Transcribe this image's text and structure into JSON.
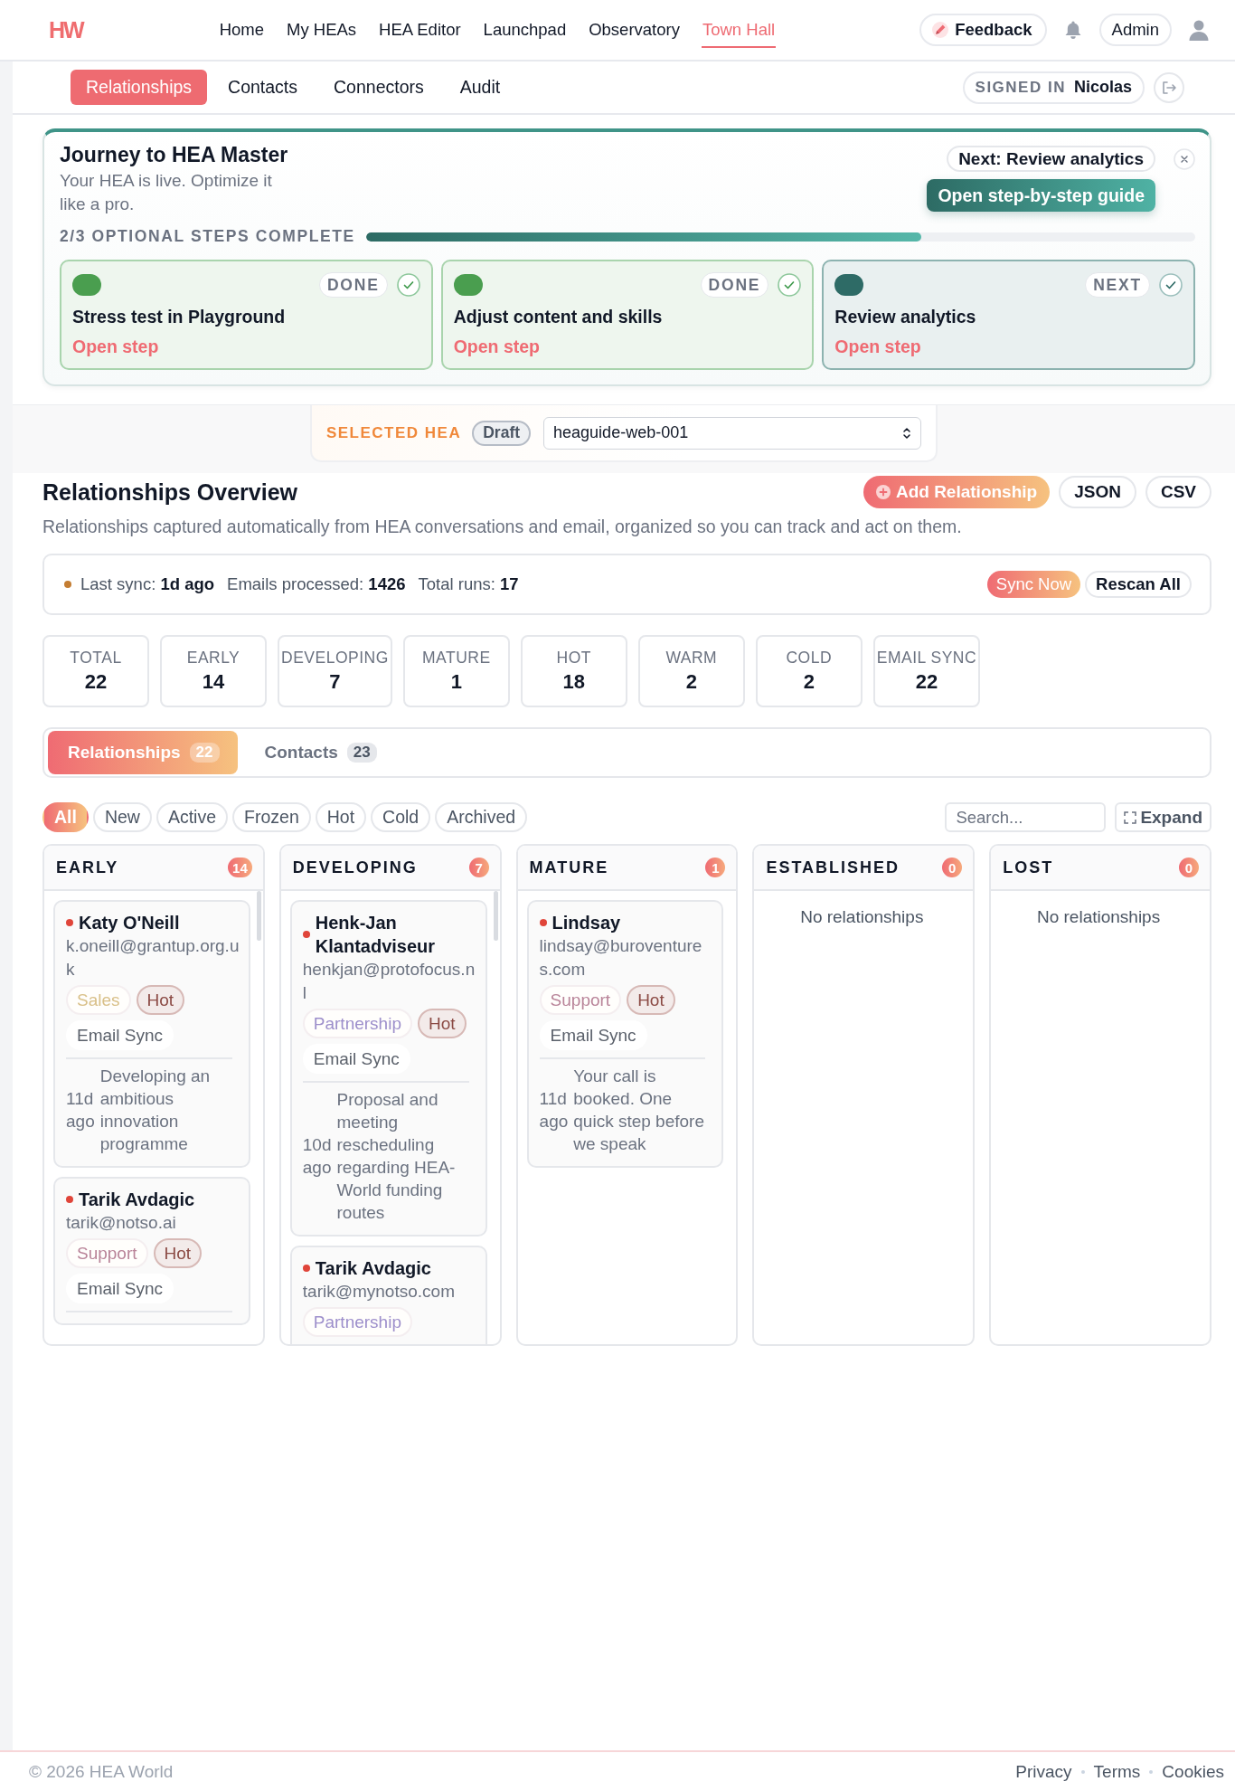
{
  "topbar": {
    "logo": "HW",
    "nav": [
      {
        "label": "Home",
        "selected": false
      },
      {
        "label": "My HEAs",
        "selected": false
      },
      {
        "label": "HEA Editor",
        "selected": false
      },
      {
        "label": "Launchpad",
        "selected": false
      },
      {
        "label": "Observatory",
        "selected": false
      },
      {
        "label": "Town Hall",
        "selected": true
      }
    ],
    "feedback": "Feedback",
    "account": "Admin"
  },
  "subnav": {
    "tabs": [
      {
        "label": "Relationships",
        "selected": true
      },
      {
        "label": "Contacts",
        "selected": false
      },
      {
        "label": "Connectors",
        "selected": false
      },
      {
        "label": "Audit",
        "selected": false
      }
    ],
    "signed_in_label": "SIGNED IN",
    "signed_in_user": "Nicolas"
  },
  "journey": {
    "title": "Journey to HEA Master",
    "subtitle": "Your HEA is live. Optimize it like a pro.",
    "next_label": "Next: Review analytics",
    "guide_button": "Open step-by-step guide",
    "progress_label": "2/3 OPTIONAL STEPS COMPLETE",
    "level": 0.67,
    "steps": [
      {
        "badge": "DONE",
        "completed": true,
        "title": "Stress test in Playground",
        "link": "Open step"
      },
      {
        "badge": "DONE",
        "completed": true,
        "title": "Adjust content and skills",
        "link": "Open step"
      },
      {
        "badge": "NEXT",
        "completed": false,
        "title": "Review analytics",
        "link": "Open step"
      }
    ]
  },
  "selected_hea": {
    "label": "SELECTED HEA",
    "status": "Draft",
    "value": "heaguide-web-001"
  },
  "overview": {
    "title": "Relationships Overview",
    "add_button": "Add Relationship",
    "export_buttons": [
      "JSON",
      "CSV"
    ],
    "description": "Relationships captured automatically from HEA conversations and email, organized so you can track and act on them."
  },
  "sync": {
    "stats": [
      "Last sync: **1d ago**",
      "Emails processed: **1426**",
      "Total runs: **17**"
    ],
    "buttons": [
      {
        "label": "Sync Now",
        "kind": "primary"
      },
      {
        "label": "Rescan All",
        "kind": "secondary"
      }
    ]
  },
  "stats": [
    {
      "label": "TOTAL",
      "value": "22"
    },
    {
      "label": "EARLY",
      "value": "14"
    },
    {
      "label": "DEVELOPING",
      "value": "7"
    },
    {
      "label": "MATURE",
      "value": "1"
    },
    {
      "label": "HOT",
      "value": "18"
    },
    {
      "label": "WARM",
      "value": "2"
    },
    {
      "label": "COLD",
      "value": "2"
    },
    {
      "label": "EMAIL SYNC",
      "value": "22"
    }
  ],
  "view_tabs": [
    {
      "label": "Relationships",
      "count": "22",
      "selected": true
    },
    {
      "label": "Contacts",
      "count": "23",
      "selected": false
    }
  ],
  "filters": [
    {
      "label": "All",
      "selected": true
    },
    {
      "label": "New",
      "selected": false
    },
    {
      "label": "Active",
      "selected": false
    },
    {
      "label": "Frozen",
      "selected": false
    },
    {
      "label": "Hot",
      "selected": false
    },
    {
      "label": "Cold",
      "selected": false
    },
    {
      "label": "Archived",
      "selected": false
    }
  ],
  "search": {
    "placeholder": "Search..."
  },
  "expand_button": "Expand",
  "columns": [
    {
      "title": "EARLY",
      "count": "14",
      "cards": [
        {
          "name": "Katy O'Neill",
          "email": "k.oneill@grantup.org.uk",
          "color": "#e0453a",
          "tags": [
            {
              "label": "Sales",
              "kind": "category",
              "color": "#d9c089"
            },
            {
              "label": "Hot",
              "kind": "heat"
            },
            {
              "label": "Email Sync",
              "kind": "source"
            }
          ],
          "time": "11d ago",
          "note": "Developing an ambitious innovation programme"
        },
        {
          "name": "Tarik Avdagic",
          "email": "tarik@notso.ai",
          "color": "#e0453a",
          "tags": [
            {
              "label": "Support",
              "kind": "category",
              "color": "#b98499"
            },
            {
              "label": "Hot",
              "kind": "heat"
            },
            {
              "label": "Email Sync",
              "kind": "source"
            }
          ]
        }
      ]
    },
    {
      "title": "DEVELOPING",
      "count": "7",
      "cards": [
        {
          "name": "Henk-Jan Klantadviseur",
          "email": "henkjan@protofocus.nl",
          "color": "#e0453a",
          "tags": [
            {
              "label": "Partnership",
              "kind": "category",
              "color": "#9d8fcb"
            },
            {
              "label": "Hot",
              "kind": "heat"
            },
            {
              "label": "Email Sync",
              "kind": "source"
            }
          ],
          "time": "10d ago",
          "note": "Proposal and meeting rescheduling regarding HEA-World funding routes"
        },
        {
          "name": "Tarik Avdagic",
          "email": "tarik@mynotso.com",
          "color": "#e0453a",
          "tags": [
            {
              "label": "Partnership",
              "kind": "category",
              "color": "#9d8fcb"
            }
          ]
        }
      ]
    },
    {
      "title": "MATURE",
      "count": "1",
      "cards": [
        {
          "name": "Lindsay",
          "email": "lindsay@buroventures.com",
          "color": "#e0453a",
          "tags": [
            {
              "label": "Support",
              "kind": "category",
              "color": "#b98499"
            },
            {
              "label": "Hot",
              "kind": "heat"
            },
            {
              "label": "Email Sync",
              "kind": "source"
            }
          ],
          "time": "11d ago",
          "note": "Your call is booked. One quick step before we speak"
        }
      ]
    },
    {
      "title": "ESTABLISHED",
      "count": "0",
      "empty_text": "No relationships"
    },
    {
      "title": "LOST",
      "count": "0",
      "empty_text": "No relationships"
    }
  ],
  "footer": {
    "copyright": "© 2026 HEA World",
    "links": [
      "Privacy",
      "Terms",
      "Cookies"
    ]
  }
}
